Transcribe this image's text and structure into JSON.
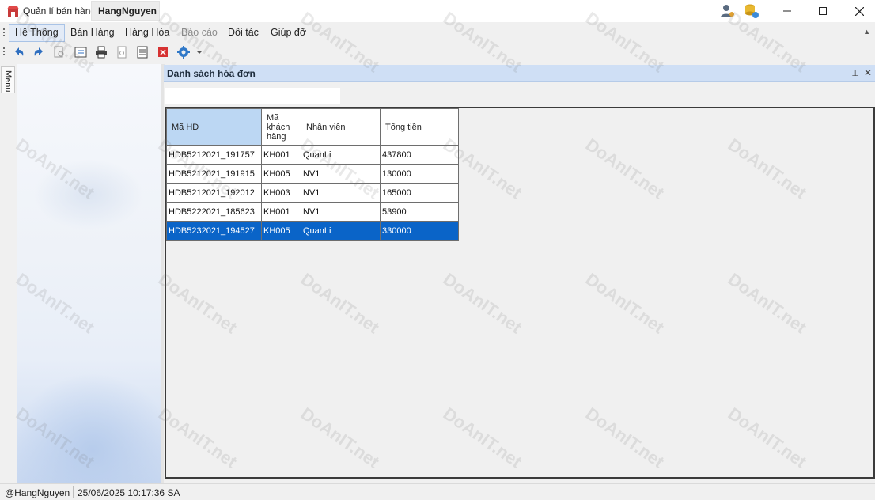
{
  "window": {
    "app_title": "Quản lí bán hàng",
    "user_tab": "HangNguyen"
  },
  "menubar": {
    "items": [
      "Hệ Thống",
      "Bán Hàng",
      "Hàng Hóa",
      "Báo cáo",
      "Đối tác",
      "Giúp đỡ"
    ]
  },
  "sidebar": {
    "tab_label": "Menu"
  },
  "document": {
    "title": "Danh sách hóa đơn",
    "search_value": ""
  },
  "grid": {
    "columns": [
      "Mã HD",
      "Mã khách hàng",
      "Nhân viên",
      "Tổng tiền"
    ],
    "rows": [
      [
        "HDB5212021_191757",
        "KH001",
        "QuanLi",
        "437800"
      ],
      [
        "HDB5212021_191915",
        "KH005",
        "NV1",
        "130000"
      ],
      [
        "HDB5212021_192012",
        "KH003",
        "NV1",
        "165000"
      ],
      [
        "HDB5222021_185623",
        "KH001",
        "NV1",
        "53900"
      ],
      [
        "HDB5232021_194527",
        "KH005",
        "QuanLi",
        "330000"
      ]
    ],
    "selected_row": 4
  },
  "statusbar": {
    "user": "@HangNguyen",
    "datetime": "25/06/2025 10:17:36 SA"
  },
  "watermark": {
    "text": "DoAnIT.net"
  },
  "colors": {
    "selection": "#0a64c8",
    "header_selected": "#bcd7f3",
    "doc_header": "#cfdff5"
  }
}
